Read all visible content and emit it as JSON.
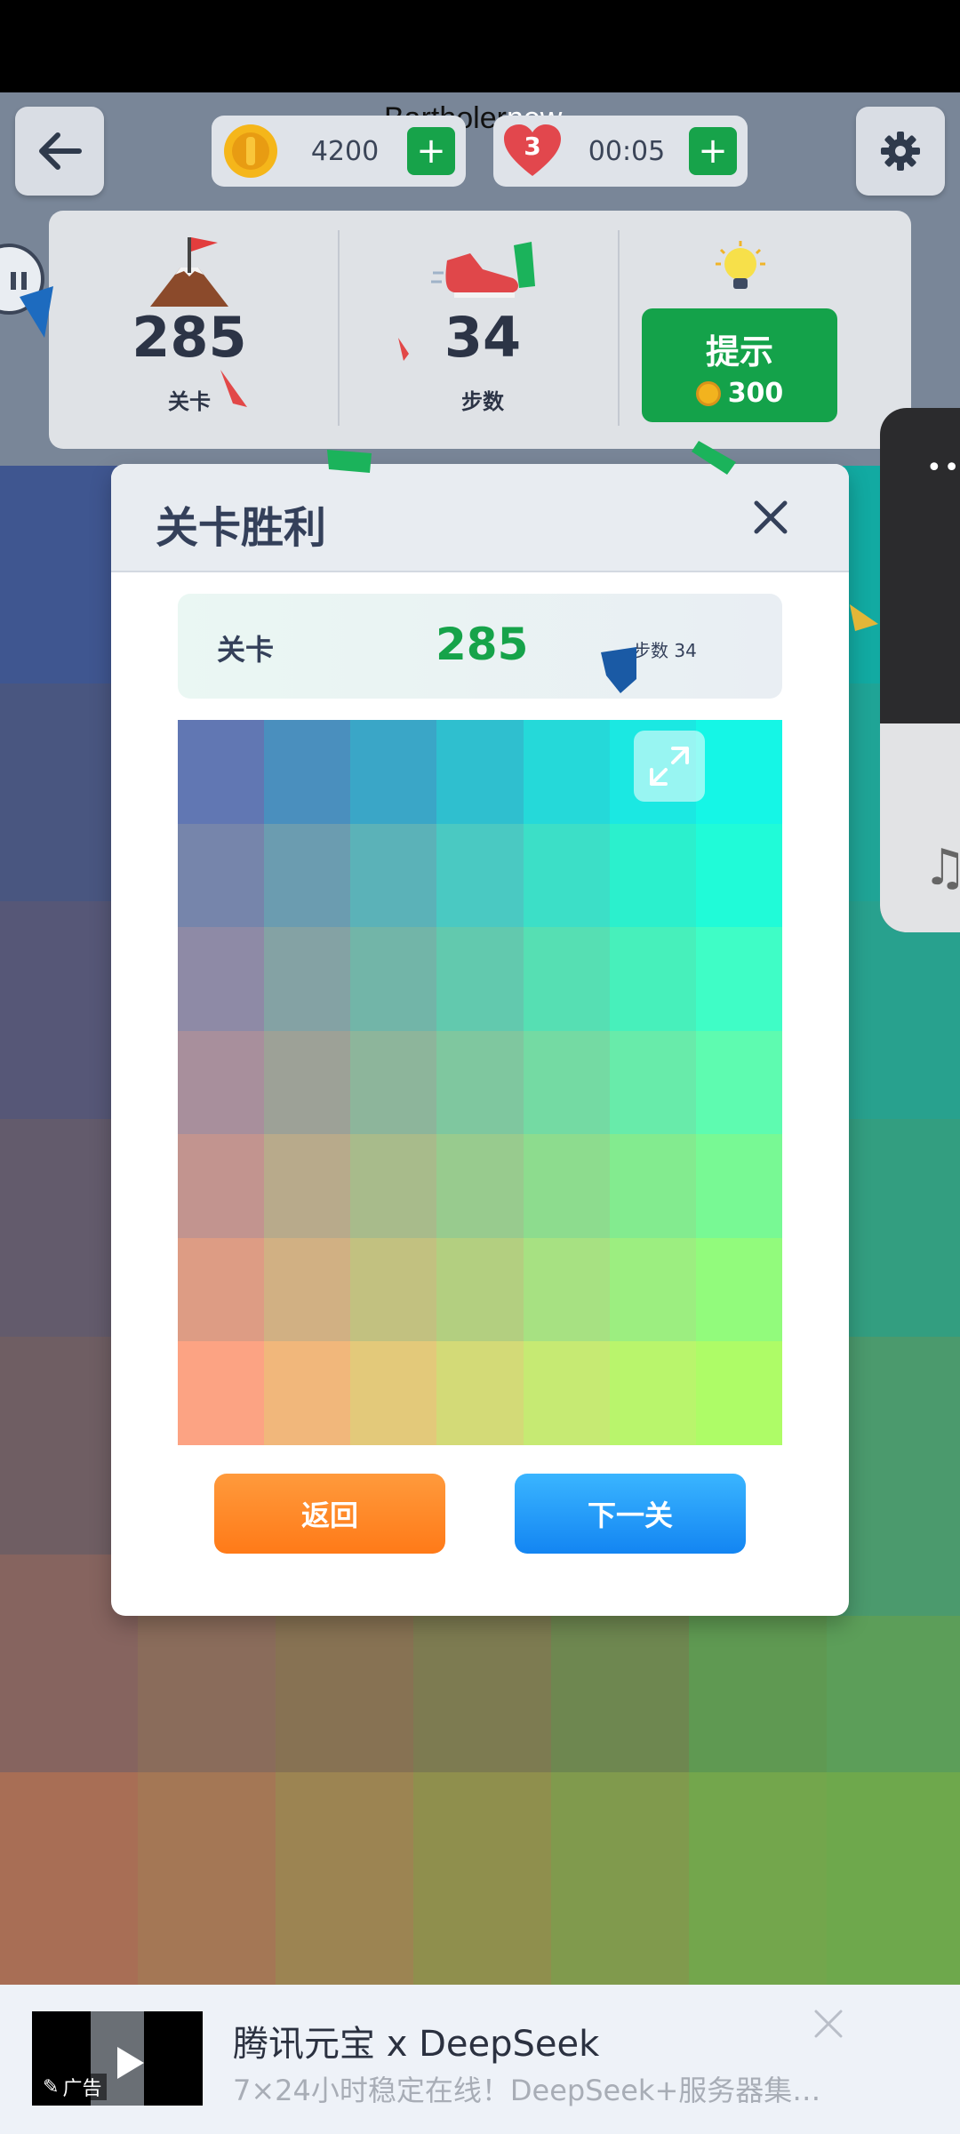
{
  "header": {
    "player_name_dark": "Bartholer",
    "player_name_light": "new",
    "coins": "4200",
    "lives": "3",
    "timer": "00:05"
  },
  "stats": {
    "level_value": "285",
    "level_label": "关卡",
    "steps_value": "34",
    "steps_label": "步数",
    "hint_label": "提示",
    "hint_cost": "300"
  },
  "modal": {
    "title": "关卡胜利",
    "level_label": "关卡",
    "level_value": "285",
    "steps_text": "步数 34",
    "back_label": "返回",
    "next_label": "下一关"
  },
  "result_grid_colors": [
    [
      "#6177b3",
      "#4a8fbe",
      "#3aa6c7",
      "#2fbfcf",
      "#25d9d9",
      "#1be8e2",
      "#15f6e6"
    ],
    [
      "#7685ab",
      "#6b9cb0",
      "#5bb2b8",
      "#4ac9c2",
      "#3cdfc7",
      "#2bf0cd",
      "#20fbd8"
    ],
    [
      "#8e8aa6",
      "#84a2a4",
      "#72b5a8",
      "#62c9ae",
      "#56dfb3",
      "#47f0bb",
      "#3ffdc6"
    ],
    [
      "#a88f9c",
      "#9da197",
      "#8db59b",
      "#7fc79f",
      "#74daa3",
      "#68ebaa",
      "#5efbb0"
    ],
    [
      "#c2948f",
      "#b8aa8b",
      "#a8bb8b",
      "#98cb8e",
      "#8ddc8e",
      "#83eb8f",
      "#78f994"
    ],
    [
      "#dd9c84",
      "#d1b083",
      "#c2c180",
      "#b3cf80",
      "#a7e182",
      "#9cee80",
      "#92fb7c"
    ],
    [
      "#fca383",
      "#f1b77b",
      "#e3c97a",
      "#d3da77",
      "#c6ea73",
      "#b9f56c",
      "#aefc67"
    ]
  ],
  "ad": {
    "tag": "广告",
    "title": "腾讯元宝 x DeepSeek",
    "description": "7×24小时稳定在线！DeepSeek+服务器集…"
  },
  "colors": {
    "accent_green": "#16a34a",
    "hint_green": "#14a24a",
    "orange_button": "#ff8a2a",
    "blue_button": "#1e90ff",
    "panel_gray": "#dfe2e6"
  }
}
